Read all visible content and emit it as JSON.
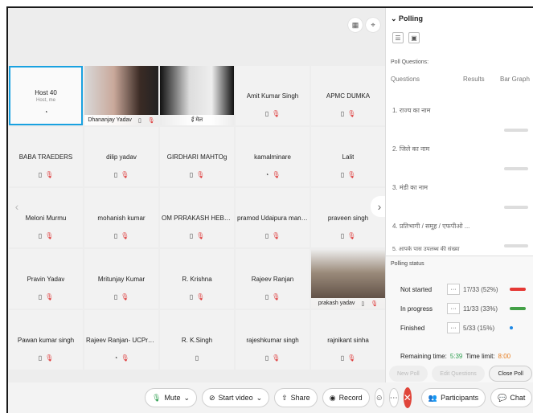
{
  "top_icons": [
    "grid-icon",
    "pin-icon"
  ],
  "participants": [
    {
      "name": "Host 40",
      "sub": "Host, me",
      "icons": [
        "headset-icon"
      ],
      "host": true
    },
    {
      "name": "Dhananjay Yadav",
      "video": true,
      "icons": [
        "device-icon",
        "mic-muted-icon"
      ]
    },
    {
      "name": "ई मेल",
      "video": true,
      "icons": []
    },
    {
      "name": "Amit Kumar Singh",
      "icons": [
        "device-icon",
        "mic-muted-icon"
      ]
    },
    {
      "name": "APMC DUMKA",
      "icons": [
        "device-icon",
        "mic-muted-icon"
      ]
    },
    {
      "name": "BABA TRAEDERS",
      "icons": [
        "device-icon",
        "mic-muted-icon"
      ]
    },
    {
      "name": "dilip yadav",
      "icons": [
        "device-icon",
        "mic-muted-icon"
      ]
    },
    {
      "name": "GIRDHARI MAHTOg",
      "icons": [
        "device-icon",
        "mic-muted-icon"
      ]
    },
    {
      "name": "kamalminare",
      "icons": [
        "headset-icon",
        "mic-muted-icon"
      ]
    },
    {
      "name": "Lalit",
      "icons": [
        "device-icon",
        "mic-muted-icon"
      ]
    },
    {
      "name": "Meloni Murmu",
      "icons": [
        "device-icon",
        "mic-muted-icon"
      ]
    },
    {
      "name": "mohanish kumar",
      "icons": [
        "device-icon",
        "mic-muted-icon"
      ]
    },
    {
      "name": "OM PRRAKASH HEBRAM",
      "icons": [
        "device-icon",
        "mic-muted-icon"
      ]
    },
    {
      "name": "pramod Udaipura mand...",
      "icons": [
        "device-icon",
        "mic-muted-icon"
      ]
    },
    {
      "name": "praveen singh",
      "icons": [
        "device-icon",
        "mic-muted-icon"
      ]
    },
    {
      "name": "Pravin Yadav",
      "icons": [
        "device-icon",
        "mic-muted-icon"
      ]
    },
    {
      "name": "Mritunjay Kumar",
      "icons": [
        "device-icon",
        "mic-muted-icon"
      ]
    },
    {
      "name": "R. Krishna",
      "icons": [
        "device-icon",
        "mic-muted-icon"
      ]
    },
    {
      "name": "Rajeev Ranjan",
      "icons": [
        "device-icon",
        "mic-muted-icon"
      ]
    },
    {
      "name": "prakash yadav",
      "video": true,
      "icons": [
        "device-icon",
        "mic-muted-icon"
      ]
    },
    {
      "name": "Pawan kumar singh",
      "icons": [
        "device-icon",
        "mic-muted-icon"
      ]
    },
    {
      "name": "Rajeev Ranjan- UCProFPC",
      "icons": [
        "headset-icon",
        "mic-muted-icon"
      ]
    },
    {
      "name": "R. K.Singh",
      "icons": [
        "device-icon"
      ]
    },
    {
      "name": "rajeshkumar singh",
      "icons": [
        "device-icon",
        "mic-muted-icon"
      ]
    },
    {
      "name": "rajnikant sinha",
      "icons": [
        "device-icon",
        "mic-muted-icon"
      ]
    }
  ],
  "toolbar": {
    "mute": "Mute",
    "start_video": "Start video",
    "share": "Share",
    "record": "Record",
    "participants": "Participants",
    "chat": "Chat"
  },
  "panel": {
    "title": "Polling",
    "questions_label": "Poll Questions:",
    "col_questions": "Questions",
    "col_results": "Results",
    "col_bar": "Bar Graph",
    "questions": [
      "1. राज्य का नाम",
      "2. जिले का नाम",
      "3. मंडी का नाम",
      "4. प्रतिभागी / समूह / एफपीओ ...",
      "5. आपके पास उपलब्ध की संख्या"
    ],
    "status_label": "Polling status",
    "statuses": [
      {
        "label": "Not started",
        "value": "17/33 (52%)",
        "color": "#e53935"
      },
      {
        "label": "In progress",
        "value": "11/33 (33%)",
        "color": "#43a047"
      },
      {
        "label": "Finished",
        "value": "5/33 (15%)",
        "color": "#1e88e5"
      }
    ],
    "remaining_label": "Remaining time:",
    "remaining_value": "5:39",
    "limit_label": "Time limit:",
    "limit_value": "8:00",
    "new_poll": "New Poll",
    "edit_questions": "Edit Questions",
    "close_poll": "Close Poll"
  }
}
